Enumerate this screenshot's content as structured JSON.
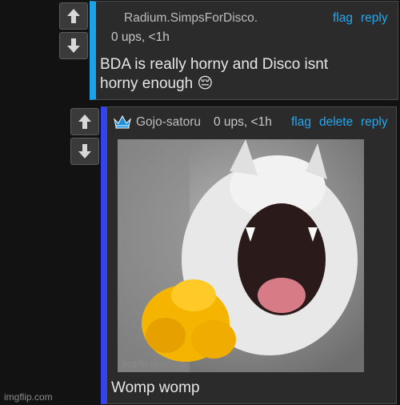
{
  "comments": [
    {
      "username": "Radium.SimpsForDisco.",
      "meta": "0 ups, <1h",
      "actions": [
        "flag",
        "reply"
      ],
      "text_line1": "BDA is really horny and Disco isnt",
      "text_line2": "horny enough",
      "emoji": "😔"
    },
    {
      "username": "Gojo-satoru",
      "meta": "0 ups, <1h",
      "actions": [
        "flag",
        "delete",
        "reply"
      ],
      "text": "Womp womp",
      "image_watermark": "imgflip.com"
    }
  ],
  "watermark": "imgflip.com",
  "colors": {
    "reply_bar_1": "#1aa3e8",
    "reply_bar_2": "#3344ee",
    "link": "#24a8f0",
    "crown": "#1c8fdc"
  },
  "icons": [
    "upvote-arrow-icon",
    "downvote-arrow-icon",
    "crown-icon"
  ]
}
